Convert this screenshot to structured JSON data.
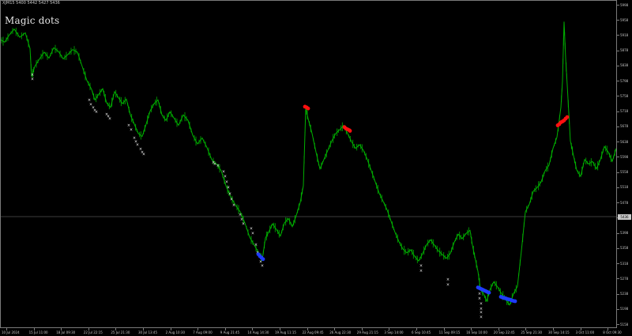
{
  "header": {
    "symbol_info": "XJM15  5400  5442  5427  5436",
    "indicator_name": "Magic dots"
  },
  "colors": {
    "background": "#000000",
    "price_line": "#00b000",
    "dot_white": "#f2f2f2",
    "dot_red": "#ff1010",
    "dot_blue": "#1e3cff",
    "grid_line": "#7a7a7a",
    "axis_text": "#c8c8c8"
  },
  "price_axis": {
    "labels": [
      "5998",
      "5958",
      "5918",
      "5878",
      "5838",
      "5798",
      "5758",
      "5718",
      "5678",
      "5638",
      "5598",
      "5558",
      "5518",
      "5478",
      "5438",
      "5398",
      "5358",
      "5318",
      "5278",
      "5238",
      "5198",
      "5158"
    ],
    "current_price": "5436"
  },
  "time_axis": {
    "labels": [
      "10 Jul 2024",
      "15 Jul 11:00",
      "18 Jul 09:30",
      "22 Jul 22:15",
      "25 Jul 21:30",
      "30 Jul 13:45",
      "2 Aug 10:30",
      "7 Aug 09:00",
      "9 Aug 21:45",
      "14 Aug 14:30",
      "19 Aug 11:15",
      "22 Aug 09:45",
      "26 Aug 22:30",
      "29 Aug 21:15",
      "3 Sep 14:00",
      "6 Sep 10:45",
      "11 Sep 09:15",
      "16 Sep 10:00",
      "20 Sep 22:45",
      "25 Sep 21:30",
      "30 Sep 14:15",
      "3 Oct 11:00",
      "8 Oct 09:30"
    ]
  },
  "chart_data": {
    "type": "line",
    "title": "Magic dots",
    "price_range": [
      5138,
      6018
    ],
    "current_price": 5436,
    "series": [
      {
        "name": "XJM15",
        "points": [
          [
            0,
            5912
          ],
          [
            6,
            5905
          ],
          [
            12,
            5925
          ],
          [
            18,
            5940
          ],
          [
            25,
            5918
          ],
          [
            32,
            5930
          ],
          [
            38,
            5888
          ],
          [
            40,
            5812
          ],
          [
            44,
            5840
          ],
          [
            50,
            5860
          ],
          [
            56,
            5878
          ],
          [
            62,
            5862
          ],
          [
            68,
            5890
          ],
          [
            74,
            5880
          ],
          [
            80,
            5860
          ],
          [
            86,
            5872
          ],
          [
            92,
            5885
          ],
          [
            98,
            5878
          ],
          [
            104,
            5840
          ],
          [
            110,
            5802
          ],
          [
            116,
            5778
          ],
          [
            120,
            5750
          ],
          [
            125,
            5765
          ],
          [
            130,
            5780
          ],
          [
            135,
            5742
          ],
          [
            140,
            5730
          ],
          [
            145,
            5772
          ],
          [
            150,
            5756
          ],
          [
            155,
            5740
          ],
          [
            160,
            5752
          ],
          [
            165,
            5710
          ],
          [
            170,
            5685
          ],
          [
            175,
            5660
          ],
          [
            180,
            5652
          ],
          [
            185,
            5685
          ],
          [
            190,
            5720
          ],
          [
            195,
            5740
          ],
          [
            200,
            5750
          ],
          [
            205,
            5710
          ],
          [
            210,
            5695
          ],
          [
            215,
            5718
          ],
          [
            220,
            5702
          ],
          [
            226,
            5682
          ],
          [
            232,
            5710
          ],
          [
            238,
            5695
          ],
          [
            244,
            5655
          ],
          [
            250,
            5632
          ],
          [
            256,
            5648
          ],
          [
            262,
            5622
          ],
          [
            268,
            5590
          ],
          [
            274,
            5578
          ],
          [
            280,
            5560
          ],
          [
            286,
            5520
          ],
          [
            292,
            5490
          ],
          [
            298,
            5468
          ],
          [
            304,
            5450
          ],
          [
            310,
            5420
          ],
          [
            316,
            5382
          ],
          [
            322,
            5360
          ],
          [
            328,
            5338
          ],
          [
            332,
            5322
          ],
          [
            336,
            5380
          ],
          [
            340,
            5395
          ],
          [
            345,
            5418
          ],
          [
            350,
            5402
          ],
          [
            355,
            5385
          ],
          [
            360,
            5420
          ],
          [
            365,
            5432
          ],
          [
            370,
            5410
          ],
          [
            375,
            5440
          ],
          [
            380,
            5475
          ],
          [
            384,
            5520
          ],
          [
            387,
            5728
          ],
          [
            390,
            5700
          ],
          [
            395,
            5660
          ],
          [
            400,
            5610
          ],
          [
            405,
            5565
          ],
          [
            410,
            5590
          ],
          [
            415,
            5615
          ],
          [
            420,
            5640
          ],
          [
            425,
            5660
          ],
          [
            430,
            5670
          ],
          [
            435,
            5682
          ],
          [
            440,
            5660
          ],
          [
            445,
            5638
          ],
          [
            450,
            5620
          ],
          [
            455,
            5630
          ],
          [
            460,
            5615
          ],
          [
            465,
            5590
          ],
          [
            470,
            5560
          ],
          [
            475,
            5530
          ],
          [
            480,
            5500
          ],
          [
            485,
            5478
          ],
          [
            490,
            5455
          ],
          [
            495,
            5425
          ],
          [
            500,
            5395
          ],
          [
            505,
            5370
          ],
          [
            510,
            5350
          ],
          [
            515,
            5340
          ],
          [
            520,
            5348
          ],
          [
            525,
            5330
          ],
          [
            530,
            5318
          ],
          [
            535,
            5338
          ],
          [
            540,
            5362
          ],
          [
            545,
            5375
          ],
          [
            550,
            5360
          ],
          [
            555,
            5345
          ],
          [
            560,
            5335
          ],
          [
            565,
            5325
          ],
          [
            570,
            5338
          ],
          [
            575,
            5368
          ],
          [
            580,
            5390
          ],
          [
            585,
            5378
          ],
          [
            590,
            5392
          ],
          [
            595,
            5400
          ],
          [
            598,
            5360
          ],
          [
            602,
            5320
          ],
          [
            605,
            5290
          ],
          [
            608,
            5245
          ],
          [
            612,
            5230
          ],
          [
            616,
            5210
          ],
          [
            620,
            5240
          ],
          [
            625,
            5262
          ],
          [
            630,
            5248
          ],
          [
            635,
            5230
          ],
          [
            640,
            5215
          ],
          [
            645,
            5200
          ],
          [
            650,
            5230
          ],
          [
            655,
            5250
          ],
          [
            660,
            5345
          ],
          [
            665,
            5450
          ],
          [
            670,
            5470
          ],
          [
            675,
            5505
          ],
          [
            680,
            5515
          ],
          [
            685,
            5530
          ],
          [
            690,
            5560
          ],
          [
            695,
            5575
          ],
          [
            700,
            5620
          ],
          [
            705,
            5650
          ],
          [
            710,
            5730
          ],
          [
            712,
            5800
          ],
          [
            714,
            5960
          ],
          [
            716,
            5862
          ],
          [
            718,
            5790
          ],
          [
            722,
            5640
          ],
          [
            726,
            5600
          ],
          [
            730,
            5562
          ],
          [
            735,
            5545
          ],
          [
            740,
            5590
          ],
          [
            745,
            5578
          ],
          [
            750,
            5585
          ],
          [
            755,
            5565
          ],
          [
            760,
            5590
          ],
          [
            765,
            5625
          ],
          [
            770,
            5610
          ],
          [
            775,
            5585
          ],
          [
            780,
            5620
          ]
        ]
      }
    ],
    "magic_dots": [
      {
        "color": "white",
        "points": [
          [
            41,
            5818
          ],
          [
            41,
            5806
          ],
          [
            113,
            5750
          ],
          [
            115,
            5738
          ],
          [
            118,
            5730
          ],
          [
            120,
            5722
          ],
          [
            122,
            5718
          ],
          [
            135,
            5712
          ],
          [
            137,
            5706
          ],
          [
            139,
            5700
          ],
          [
            163,
            5682
          ],
          [
            166,
            5670
          ],
          [
            170,
            5648
          ],
          [
            172,
            5638
          ],
          [
            174,
            5630
          ],
          [
            178,
            5618
          ],
          [
            180,
            5610
          ],
          [
            182,
            5604
          ],
          [
            270,
            5582
          ],
          [
            272,
            5578
          ],
          [
            276,
            5574
          ],
          [
            283,
            5558
          ],
          [
            285,
            5545
          ],
          [
            287,
            5530
          ],
          [
            289,
            5515
          ],
          [
            291,
            5498
          ],
          [
            293,
            5484
          ],
          [
            296,
            5468
          ],
          [
            304,
            5442
          ],
          [
            306,
            5430
          ],
          [
            308,
            5418
          ],
          [
            318,
            5405
          ],
          [
            320,
            5392
          ],
          [
            324,
            5362
          ],
          [
            326,
            5340
          ],
          [
            330,
            5316
          ],
          [
            332,
            5306
          ],
          [
            533,
            5305
          ],
          [
            533,
            5292
          ],
          [
            567,
            5268
          ],
          [
            567,
            5255
          ],
          [
            607,
            5230
          ],
          [
            607,
            5218
          ],
          [
            609,
            5204
          ],
          [
            609,
            5190
          ],
          [
            609,
            5180
          ],
          [
            609,
            5168
          ]
        ]
      },
      {
        "color": "red",
        "points": [
          [
            386,
            5732
          ],
          [
            388,
            5730
          ],
          [
            390,
            5727
          ],
          [
            436,
            5677
          ],
          [
            438,
            5673
          ],
          [
            440,
            5671
          ],
          [
            442,
            5669
          ],
          [
            443,
            5667
          ],
          [
            706,
            5682
          ],
          [
            708,
            5685
          ],
          [
            710,
            5690
          ],
          [
            712,
            5692
          ],
          [
            714,
            5695
          ],
          [
            716,
            5700
          ],
          [
            718,
            5704
          ]
        ]
      },
      {
        "color": "blue",
        "points": [
          [
            327,
            5336
          ],
          [
            329,
            5331
          ],
          [
            331,
            5327
          ],
          [
            333,
            5323
          ],
          [
            605,
            5247
          ],
          [
            607,
            5245
          ],
          [
            609,
            5243
          ],
          [
            611,
            5241
          ],
          [
            613,
            5239
          ],
          [
            615,
            5237
          ],
          [
            617,
            5235
          ],
          [
            619,
            5233
          ],
          [
            634,
            5222
          ],
          [
            636,
            5220
          ],
          [
            638,
            5219
          ],
          [
            640,
            5218
          ],
          [
            642,
            5216
          ],
          [
            644,
            5215
          ],
          [
            646,
            5214
          ],
          [
            648,
            5212
          ],
          [
            650,
            5211
          ],
          [
            652,
            5210
          ]
        ]
      }
    ]
  }
}
